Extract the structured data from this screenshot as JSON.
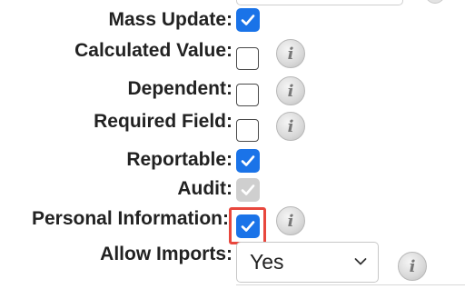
{
  "fields": [
    {
      "label": "Mass Update:",
      "state": "checked"
    },
    {
      "label": "Calculated Value:",
      "state": "unchecked",
      "info": true
    },
    {
      "label": "Dependent:",
      "state": "unchecked",
      "info": true
    },
    {
      "label": "Required Field:",
      "state": "unchecked",
      "info": true
    },
    {
      "label": "Reportable:",
      "state": "checked"
    },
    {
      "label": "Audit:",
      "state": "disabled-checked"
    },
    {
      "label": "Personal Information:",
      "state": "checked",
      "info": true,
      "highlighted": true
    },
    {
      "label": "Allow Imports:",
      "control": "select",
      "value": "Yes",
      "info": true
    }
  ],
  "info_glyph": "i",
  "colors": {
    "accent": "#1a73e8",
    "highlight": "#e8473d",
    "disabled": "#cfcfcf"
  }
}
